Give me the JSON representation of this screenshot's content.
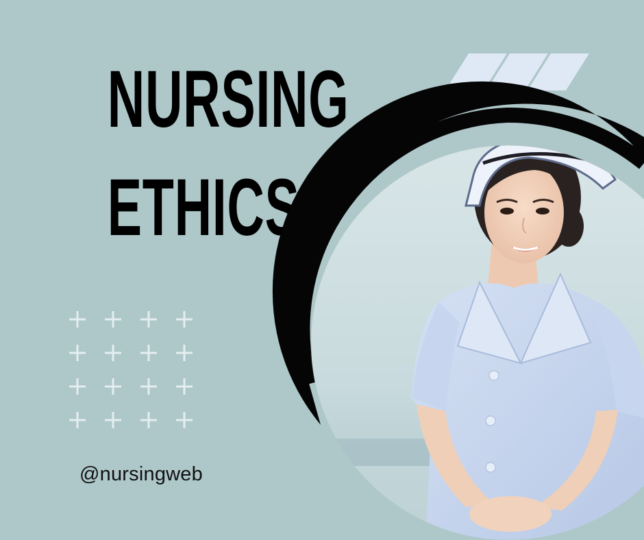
{
  "poster": {
    "title_line1": "NURSING",
    "title_line2": "ETHICS",
    "handle": "@nursingweb"
  },
  "colors": {
    "background": "#aec7c9",
    "title": "#000000",
    "stripes": "#dfe9f5",
    "plus_marks": "#e4eef0",
    "arc": "#050505",
    "uniform": "#c9d7ee"
  },
  "decor": {
    "stripe_count": 3,
    "plus_rows": 4,
    "plus_cols": 4,
    "photo_subject": "smiling-nurse-portrait"
  }
}
